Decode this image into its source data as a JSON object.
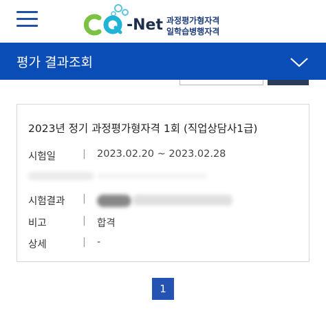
{
  "header": {
    "logo_alt_icon": "cq-net-logo",
    "logo_net": "-Net",
    "logo_line1": "과정평가형자격",
    "logo_line2": "일학습병행자격",
    "menu_icon": "hamburger-icon"
  },
  "title_bar": {
    "title": "평가 결과조회",
    "toggle_icon": "chevron-down-icon"
  },
  "result": {
    "title": "2023년 정기 과정평가형자격 1회 (직업상담사1급)",
    "rows": [
      {
        "label": "시험일",
        "value": "2023.02.20 ~ 2023.02.28"
      },
      {
        "label": "",
        "value": ""
      },
      {
        "label": "시험결과",
        "value": ""
      },
      {
        "label": "비고",
        "value": "합격"
      },
      {
        "label": "상세",
        "value": "-"
      }
    ]
  },
  "pagination": {
    "current": "1"
  },
  "colors": {
    "brand_blue": "#0a4db6",
    "page_btn": "#2453b3",
    "logo_green": "#7cc242",
    "logo_teal": "#1fb3d6"
  }
}
